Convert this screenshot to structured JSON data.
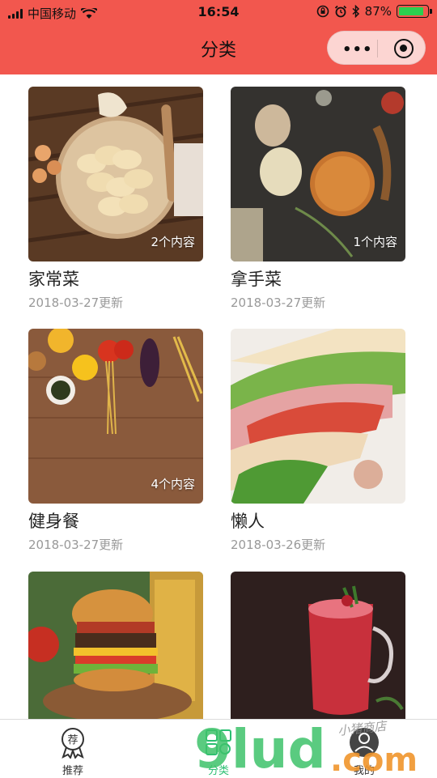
{
  "status_bar": {
    "carrier": "中国移动",
    "time": "16:54",
    "battery": "87%",
    "battery_level": 0.87
  },
  "nav": {
    "title": "分类"
  },
  "categories": [
    {
      "name": "家常菜",
      "count": "2个内容",
      "updated": "2018-03-27更新"
    },
    {
      "name": "拿手菜",
      "count": "1个内容",
      "updated": "2018-03-27更新"
    },
    {
      "name": "健身餐",
      "count": "4个内容",
      "updated": "2018-03-27更新"
    },
    {
      "name": "懒人",
      "count": "",
      "updated": "2018-03-26更新"
    },
    {
      "name": "",
      "count": "",
      "updated": ""
    },
    {
      "name": "",
      "count": "",
      "updated": ""
    }
  ],
  "tabbar": {
    "items": [
      {
        "label": "推荐",
        "icon": "recommend-badge-icon",
        "active": false
      },
      {
        "label": "分类",
        "icon": "category-grid-icon",
        "active": true
      },
      {
        "label": "我的",
        "icon": "user-icon",
        "active": false
      }
    ]
  },
  "watermark": {
    "logo": "9lud",
    "suffix": ".com",
    "handwriting": "小猪商店"
  },
  "colors": {
    "header": "#f2574e",
    "active_tab": "#2bbf72",
    "watermark_green": "#3ec26a",
    "watermark_orange": "#f0952c"
  }
}
